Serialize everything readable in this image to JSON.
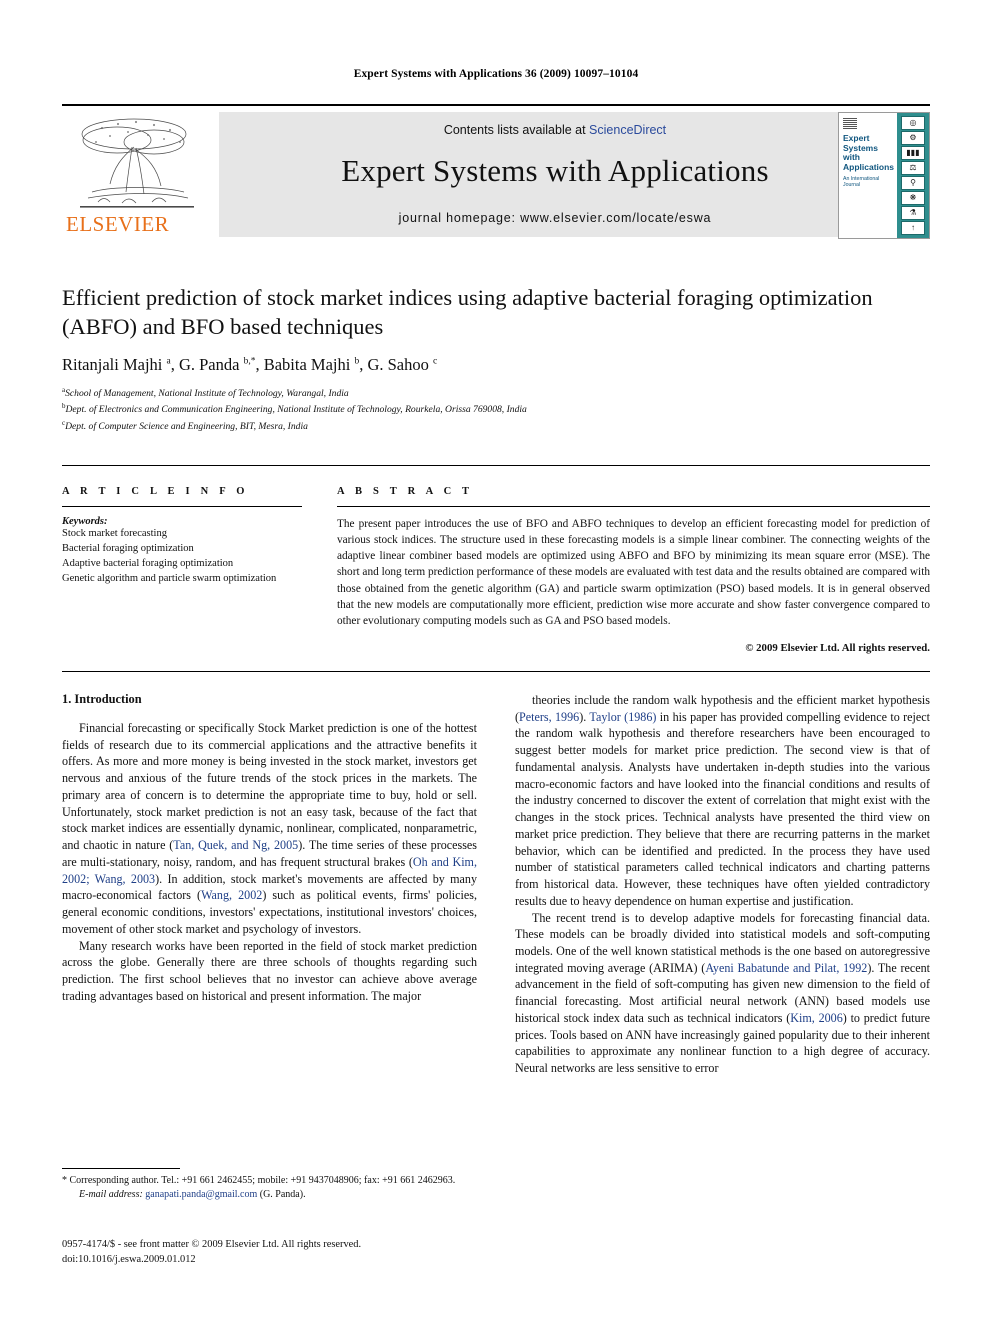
{
  "running_head": "Expert Systems with Applications 36 (2009) 10097–10104",
  "header": {
    "publisher_name": "ELSEVIER",
    "contents_prefix": "Contents lists available at ",
    "contents_link": "ScienceDirect",
    "journal_title": "Expert Systems with Applications",
    "homepage_label": "journal homepage: www.elsevier.com/locate/eswa",
    "cover": {
      "title": "Expert Systems with Applications",
      "subtitle": "An International Journal",
      "icons": [
        "globe-icon",
        "gears-icon",
        "bar-chart-icon",
        "balance-icon",
        "microscope-icon",
        "atom-icon",
        "flask-icon",
        "arrow-icon"
      ]
    }
  },
  "article": {
    "title": "Efficient prediction of stock market indices using adaptive bacterial foraging optimization (ABFO) and BFO based techniques",
    "authors_html": "Ritanjali Majhi <sup>a</sup>, G. Panda <sup>b,*</sup>, Babita Majhi <sup>b</sup>, G. Sahoo <sup>c</sup>",
    "affiliations": [
      "School of Management, National Institute of Technology, Warangal, India",
      "Dept. of Electronics and Communication Engineering, National Institute of Technology, Rourkela, Orissa 769008, India",
      "Dept. of Computer Science and Engineering, BIT, Mesra, India"
    ],
    "affiliation_marks": [
      "a",
      "b",
      "c"
    ]
  },
  "article_info": {
    "heading": "A R T I C L E  I N F O",
    "keywords_label": "Keywords:",
    "keywords": [
      "Stock market forecasting",
      "Bacterial foraging optimization",
      "Adaptive bacterial foraging optimization",
      "Genetic algorithm and particle swarm optimization"
    ]
  },
  "abstract": {
    "heading": "A B S T R A C T",
    "text": "The present paper introduces the use of BFO and ABFO techniques to develop an efficient forecasting model for prediction of various stock indices. The structure used in these forecasting models is a simple linear combiner. The connecting weights of the adaptive linear combiner based models are optimized using ABFO and BFO by minimizing its mean square error (MSE). The short and long term prediction performance of these models are evaluated with test data and the results obtained are compared with those obtained from the genetic algorithm (GA) and particle swarm optimization (PSO) based models. It is in general observed that the new models are computationally more efficient, prediction wise more accurate and show faster convergence compared to other evolutionary computing models such as GA and PSO based models.",
    "copyright": "© 2009 Elsevier Ltd. All rights reserved."
  },
  "body": {
    "section_heading": "1. Introduction",
    "left_paragraphs": [
      {
        "segments": [
          {
            "t": "Financial forecasting or specifically Stock Market prediction is one of the hottest fields of research due to its commercial applications and the attractive benefits it offers. As more and more money is being invested in the stock market, investors get nervous and anxious of the future trends of the stock prices in the markets. The primary area of concern is to determine the appropriate time to buy, hold or sell. Unfortunately, stock market prediction is not an easy task, because of the fact that stock market indices are essentially dynamic, nonlinear, complicated, nonparametric, and chaotic in nature ("
          },
          {
            "t": "Tan, Quek, and Ng, 2005",
            "cite": true
          },
          {
            "t": "). The time series of these processes are multi-stationary, noisy, random, and has frequent structural brakes ("
          },
          {
            "t": "Oh and Kim, 2002; Wang, 2003",
            "cite": true
          },
          {
            "t": "). In addition, stock market's movements are affected by many macro-economical factors ("
          },
          {
            "t": "Wang, 2002",
            "cite": true
          },
          {
            "t": ") such as political events, firms' policies, general economic conditions, investors' expectations, institutional investors' choices, movement of other stock market and psychology of investors."
          }
        ]
      },
      {
        "segments": [
          {
            "t": "Many research works have been reported in the field of stock market prediction across the globe. Generally there are three schools of thoughts regarding such prediction. The first school believes that no investor can achieve above average trading advantages based on historical and present information. The major"
          }
        ]
      }
    ],
    "right_paragraphs": [
      {
        "segments": [
          {
            "t": "theories include the random walk hypothesis and the efficient market hypothesis ("
          },
          {
            "t": "Peters, 1996",
            "cite": true
          },
          {
            "t": "). "
          },
          {
            "t": "Taylor (1986)",
            "cite": true
          },
          {
            "t": " in his paper has provided compelling evidence to reject the random walk hypothesis and therefore researchers have been encouraged to suggest better models for market price prediction. The second view is that of fundamental analysis. Analysts have undertaken in-depth studies into the various macro-economic factors and have looked into the financial conditions and results of the industry concerned to discover the extent of correlation that might exist with the changes in the stock prices. Technical analysts have presented the third view on market price prediction. They believe that there are recurring patterns in the market behavior, which can be identified and predicted. In the process they have used number of statistical parameters called technical indicators and charting patterns from historical data. However, these techniques have often yielded contradictory results due to heavy dependence on human expertise and justification."
          }
        ]
      },
      {
        "segments": [
          {
            "t": "The recent trend is to develop adaptive models for forecasting financial data. These models can be broadly divided into statistical models and soft-computing models. One of the well known statistical methods is the one based on autoregressive integrated moving average (ARIMA) ("
          },
          {
            "t": "Ayeni Babatunde and Pilat, 1992",
            "cite": true
          },
          {
            "t": "). The recent advancement in the field of soft-computing has given new dimension to the field of financial forecasting. Most artificial neural network (ANN) based models use historical stock index data such as technical indicators ("
          },
          {
            "t": "Kim, 2006",
            "cite": true
          },
          {
            "t": ") to predict future prices. Tools based on ANN have increasingly gained popularity due to their inherent capabilities to approximate any nonlinear function to a high degree of accuracy. Neural networks are less sensitive to error"
          }
        ]
      }
    ]
  },
  "footnote": {
    "corresponding": "* Corresponding author. Tel.: +91 661 2462455; mobile: +91 9437048906; fax: +91 661 2462963.",
    "email_label": "E-mail address:",
    "email": "ganapati.panda@gmail.com",
    "email_suffix": "(G. Panda)."
  },
  "footer": {
    "issn_line": "0957-4174/$ - see front matter © 2009 Elsevier Ltd. All rights reserved.",
    "doi_line": "doi:10.1016/j.eswa.2009.01.012"
  },
  "colors": {
    "link": "#2a4a9c",
    "citation": "#1f3f87",
    "elsevier_orange": "#e8701a",
    "panel_grey": "#e6e6e6",
    "cover_teal": "#2f8e8e"
  }
}
